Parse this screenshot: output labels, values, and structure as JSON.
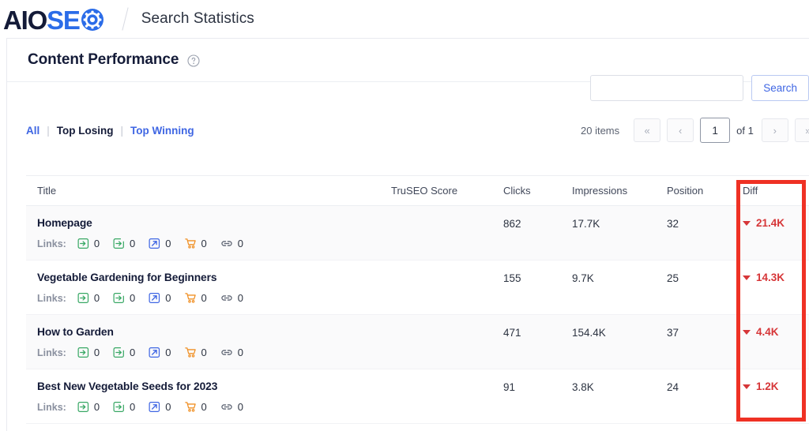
{
  "topbar": {
    "logo_aio": "AIO",
    "logo_seo": "SEO",
    "separator": "/",
    "title": "Search Statistics"
  },
  "card": {
    "title": "Content Performance",
    "help_icon": "help-circle-icon"
  },
  "search": {
    "value": "",
    "placeholder": "",
    "button_label": "Search"
  },
  "filters": {
    "all": "All",
    "divider": "|",
    "top_losing": "Top Losing",
    "top_winning": "Top Winning"
  },
  "pagination": {
    "items_count": "20 items",
    "first_label": "«",
    "prev_label": "‹",
    "page_value": "1",
    "of_label": "of 1",
    "next_label": "›",
    "last_label": "»"
  },
  "table": {
    "headers": {
      "title": "Title",
      "truseo": "TruSEO Score",
      "clicks": "Clicks",
      "impressions": "Impressions",
      "position": "Position",
      "diff": "Diff"
    },
    "links_label": "Links:",
    "rows": [
      {
        "title": "Homepage",
        "truseo": "",
        "clicks": "862",
        "impressions": "17.7K",
        "position": "32",
        "diff": "21.4K",
        "diff_direction": "down",
        "links": {
          "internal_in": "0",
          "internal_out": "0",
          "external": "0",
          "affiliate": "0",
          "total": "0"
        }
      },
      {
        "title": "Vegetable Gardening for Beginners",
        "truseo": "",
        "clicks": "155",
        "impressions": "9.7K",
        "position": "25",
        "diff": "14.3K",
        "diff_direction": "down",
        "links": {
          "internal_in": "0",
          "internal_out": "0",
          "external": "0",
          "affiliate": "0",
          "total": "0"
        }
      },
      {
        "title": "How to Garden",
        "truseo": "",
        "clicks": "471",
        "impressions": "154.4K",
        "position": "37",
        "diff": "4.4K",
        "diff_direction": "down",
        "links": {
          "internal_in": "0",
          "internal_out": "0",
          "external": "0",
          "affiliate": "0",
          "total": "0"
        }
      },
      {
        "title": "Best New Vegetable Seeds for 2023",
        "truseo": "",
        "clicks": "91",
        "impressions": "3.8K",
        "position": "24",
        "diff": "1.2K",
        "diff_direction": "down",
        "links": {
          "internal_in": "0",
          "internal_out": "0",
          "external": "0",
          "affiliate": "0",
          "total": "0"
        }
      }
    ]
  },
  "annotation": {
    "highlight_color": "#ef3124",
    "target_column": "Diff"
  },
  "colors": {
    "brand_dark": "#141b38",
    "brand_blue": "#2b6ce8",
    "link_blue": "#3f66e3",
    "negative_red": "#d63638",
    "icon_green": "#39a865",
    "icon_blue": "#3f66e3",
    "icon_orange": "#f09025",
    "icon_gray": "#5b6271"
  }
}
